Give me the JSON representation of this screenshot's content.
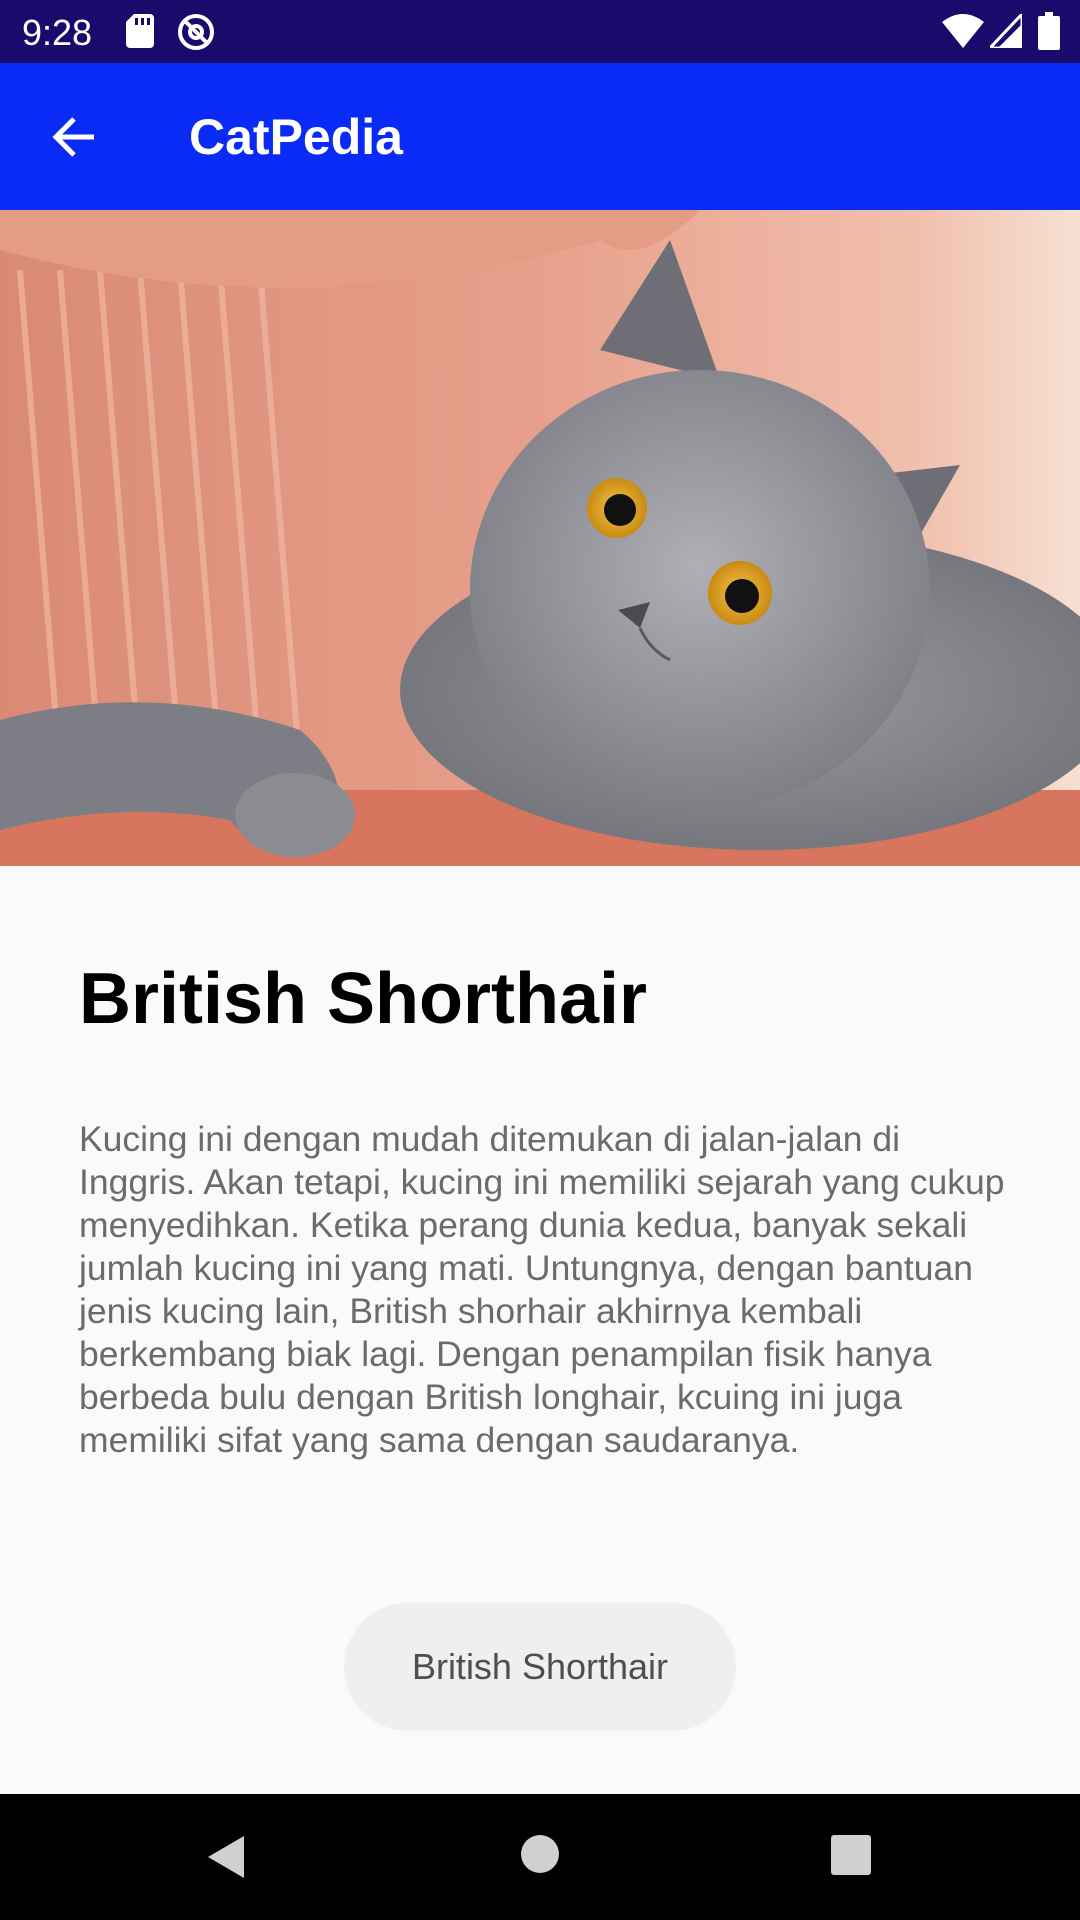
{
  "status_bar": {
    "time": "9:28",
    "icons": [
      "sd-card-icon",
      "at-sign-icon",
      "wifi-icon",
      "signal-icon",
      "battery-icon"
    ]
  },
  "app_bar": {
    "title": "CatPedia",
    "back_icon": "arrow-left-icon",
    "background": "#0a2bf5"
  },
  "hero": {
    "image": "gray-cat-on-sofa-photo"
  },
  "breed": {
    "name": "British Shorthair",
    "description": "Kucing ini dengan mudah ditemukan di jalan-jalan di Inggris. Akan tetapi, kucing ini memiliki sejarah yang cukup menyedihkan. Ketika perang dunia kedua, banyak sekali jumlah kucing ini yang mati. Untungnya, dengan bantuan jenis kucing lain, British shorhair akhirnya kembali berkembang biak lagi. Dengan penampilan fisik hanya berbeda bulu dengan British longhair, kcuing ini juga memiliki sifat yang sama dengan saudaranya.",
    "chip_label": "British Shorthair"
  },
  "nav_bar": {
    "icons": [
      "nav-back-icon",
      "nav-home-icon",
      "nav-recents-icon"
    ]
  },
  "colors": {
    "status_bar": "#1a0a6b",
    "app_bar": "#0a2bf5",
    "background": "#fafafa",
    "chip": "#efefef"
  }
}
